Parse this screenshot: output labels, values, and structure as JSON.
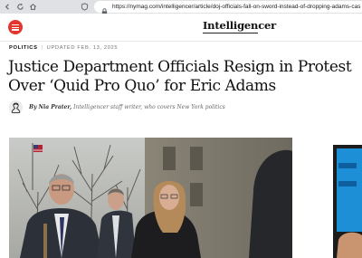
{
  "browser": {
    "url": "https://nymag.com/intelligencer/article/doj-officials-fall-on-sword-instead-of-dropping-adams-cas",
    "icons": [
      "back-arrow-icon",
      "reload-icon",
      "home-icon",
      "shield-icon",
      "lock-icon"
    ]
  },
  "site": {
    "logo": "Intelligencer",
    "menu_icon": "hamburger-menu-icon",
    "brand_color": "#e5352d"
  },
  "article": {
    "section": "POLITICS",
    "updated": "UPDATED FEB. 13, 2025",
    "headline": "Justice Department Officials Resign in Protest Over ‘Quid Pro Quo’ for Eric Adams",
    "byline": {
      "prefix": "By",
      "author": "Nia Prater,",
      "description": "Intelligencer staff writer, who covers New York politics"
    }
  }
}
